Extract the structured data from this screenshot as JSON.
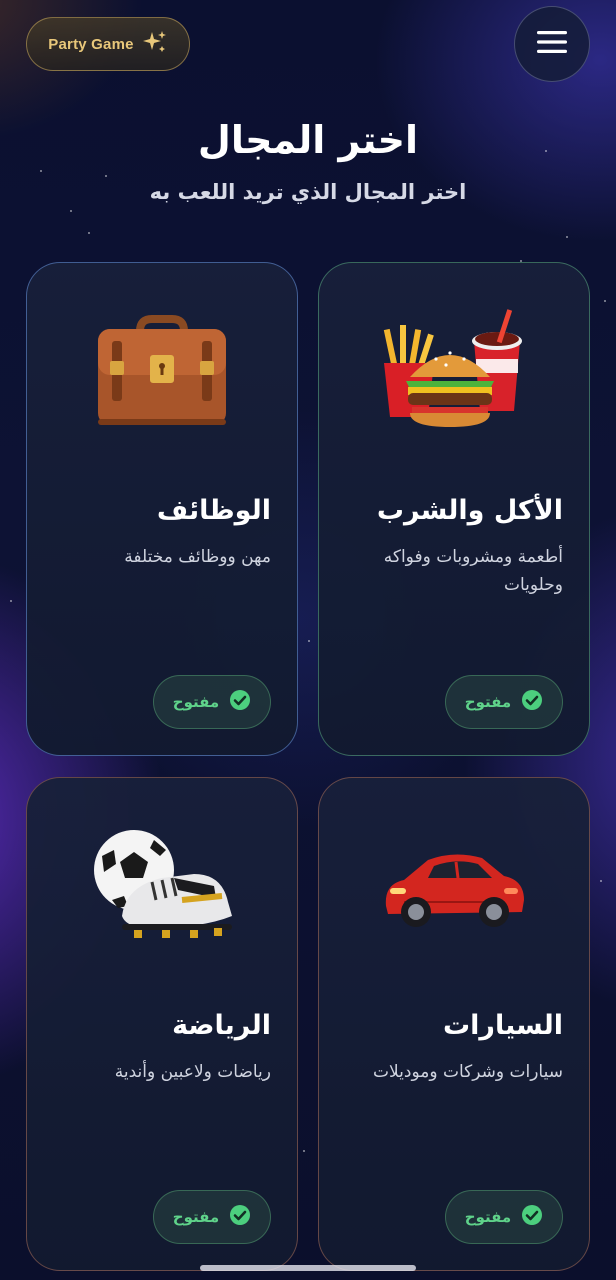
{
  "header": {
    "badge_label": "Party Game",
    "badge_icon": "sparkles-icon",
    "menu_icon": "hamburger-menu-icon"
  },
  "main": {
    "title": "اختر المجال",
    "subtitle": "اختر المجال الذي تريد اللعب به"
  },
  "categories": [
    {
      "title": "الأكل والشرب",
      "description": "أطعمة ومشروبات وفواكه وحلويات",
      "status": "مفتوح",
      "icon": "burger-fries-drink-icon"
    },
    {
      "title": "الوظائف",
      "description": "مهن ووظائف مختلفة",
      "status": "مفتوح",
      "icon": "briefcase-icon"
    },
    {
      "title": "السيارات",
      "description": "سيارات وشركات وموديلات",
      "status": "مفتوح",
      "icon": "red-car-icon"
    },
    {
      "title": "الرياضة",
      "description": "رياضات ولاعبين وأندية",
      "status": "مفتوح",
      "icon": "football-boot-icon"
    }
  ],
  "colors": {
    "accent_gold": "#e8c77a",
    "status_green": "#5fd38a",
    "background": "#0b1030"
  }
}
